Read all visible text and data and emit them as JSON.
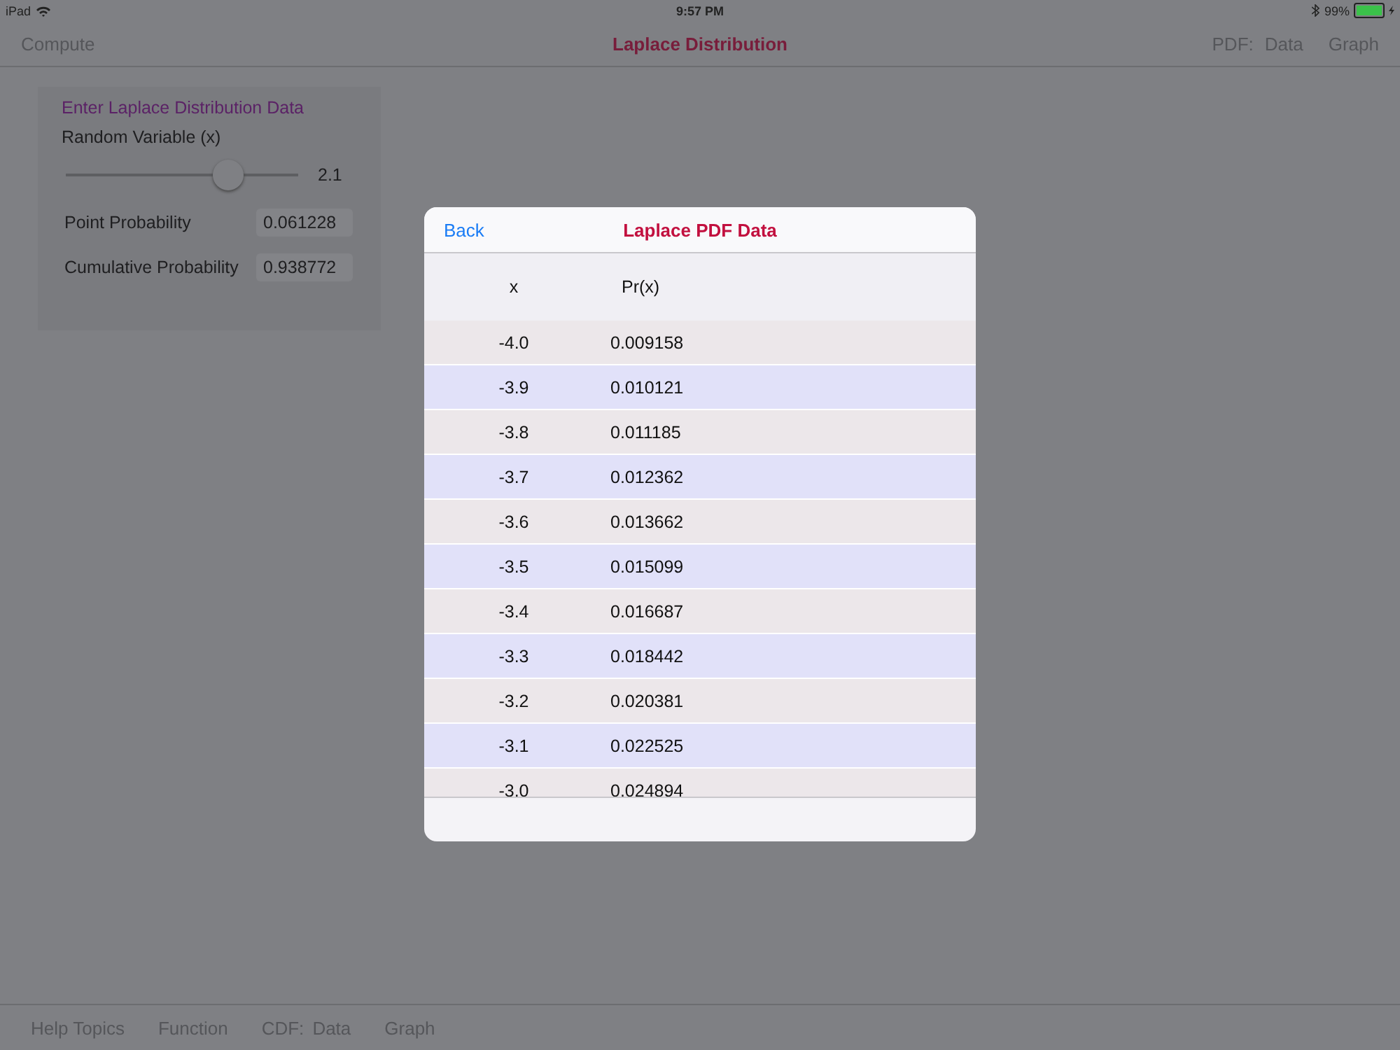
{
  "status_bar": {
    "device": "iPad",
    "time": "9:57 PM",
    "battery": "99%"
  },
  "nav_bar": {
    "left_button": "Compute",
    "title": "Laplace Distribution",
    "section_label": "PDF:",
    "section_links": [
      "Data",
      "Graph"
    ]
  },
  "input_panel": {
    "heading": "Enter Laplace Distribution Data",
    "slider": {
      "label": "Random Variable (x)",
      "level": 0.73,
      "value": "2.1"
    },
    "fields": [
      {
        "label": "Point Probability",
        "value": "0.061228"
      },
      {
        "label": "Cumulative Probability",
        "value": "0.938772"
      }
    ]
  },
  "modal": {
    "back": "Back",
    "title": "Laplace PDF Data",
    "columns": [
      "x",
      "Pr(x)"
    ],
    "rows": [
      [
        "-4.0",
        "0.009158"
      ],
      [
        "-3.9",
        "0.010121"
      ],
      [
        "-3.8",
        "0.011185"
      ],
      [
        "-3.7",
        "0.012362"
      ],
      [
        "-3.6",
        "0.013662"
      ],
      [
        "-3.5",
        "0.015099"
      ],
      [
        "-3.4",
        "0.016687"
      ],
      [
        "-3.3",
        "0.018442"
      ],
      [
        "-3.2",
        "0.020381"
      ],
      [
        "-3.1",
        "0.022525"
      ],
      [
        "-3.0",
        "0.024894"
      ]
    ]
  },
  "toolbar": {
    "buttons": [
      "Help Topics",
      "Function"
    ],
    "section_label": "CDF:",
    "section_links": [
      "Data",
      "Graph"
    ]
  }
}
